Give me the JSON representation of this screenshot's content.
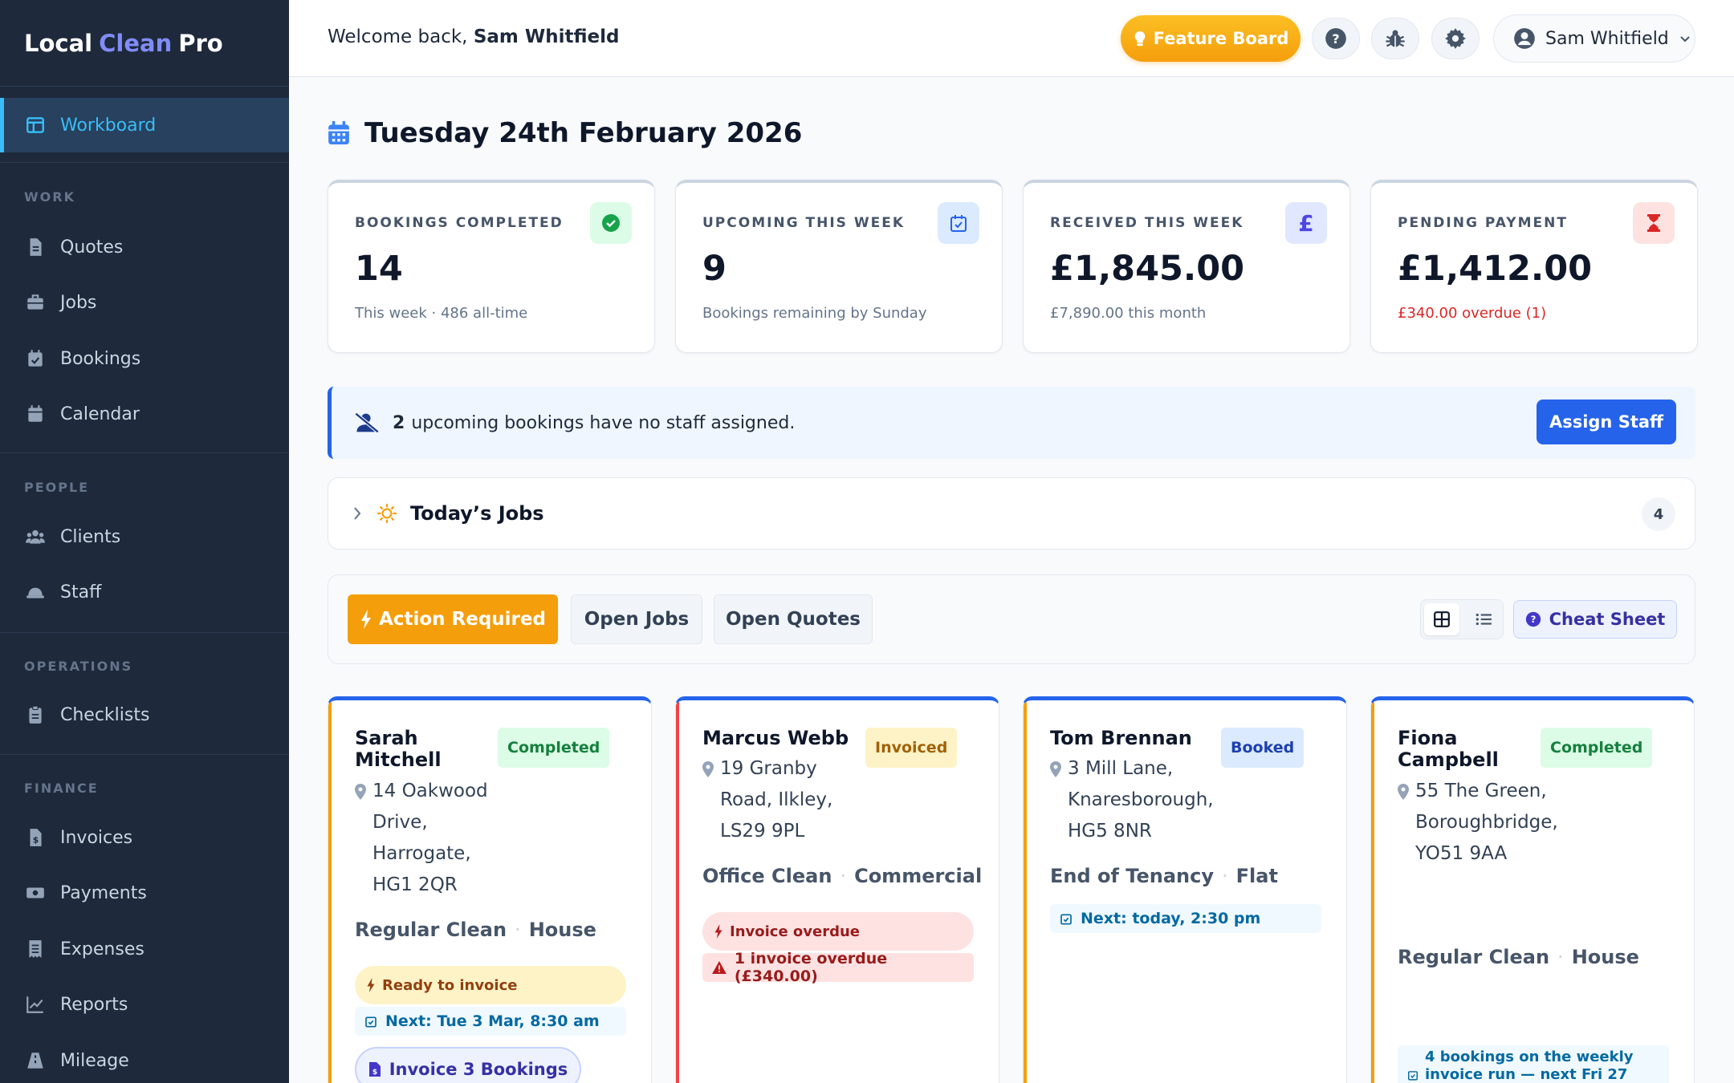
{
  "brand": {
    "part1": "Local",
    "part2": "Clean",
    "part3": "Pro"
  },
  "sidebar": {
    "active": "Workboard",
    "sections": {
      "work": "WORK",
      "people": "PEOPLE",
      "operations": "OPERATIONS",
      "finance": "FINANCE"
    },
    "items": {
      "quotes": "Quotes",
      "jobs": "Jobs",
      "bookings": "Bookings",
      "calendar": "Calendar",
      "clients": "Clients",
      "staff": "Staff",
      "checklists": "Checklists",
      "invoices": "Invoices",
      "payments": "Payments",
      "expenses": "Expenses",
      "reports": "Reports",
      "mileage": "Mileage"
    }
  },
  "topbar": {
    "welcome_prefix": "Welcome back,",
    "user_name": "Sam Whitfield",
    "feature_board": "Feature Board"
  },
  "page": {
    "date": "Tuesday 24th February 2026"
  },
  "stats": [
    {
      "label": "BOOKINGS COMPLETED",
      "value": "14",
      "sub": "This week · 486 all-time"
    },
    {
      "label": "UPCOMING THIS WEEK",
      "value": "9",
      "sub": "Bookings remaining by Sunday"
    },
    {
      "label": "RECEIVED THIS WEEK",
      "value": "£1,845.00",
      "sub": "£7,890.00 this month",
      "icon_text": "£"
    },
    {
      "label": "PENDING PAYMENT",
      "value": "£1,412.00",
      "sub": "£340.00 overdue (1)"
    }
  ],
  "alert": {
    "count": "2",
    "text": "upcoming bookings have no staff assigned.",
    "button": "Assign Staff"
  },
  "today": {
    "title": "Today’s Jobs",
    "count": "4"
  },
  "tabs": {
    "action": "Action Required",
    "jobs": "Open Jobs",
    "quotes": "Open Quotes",
    "cheat": "Cheat Sheet"
  },
  "cards": [
    {
      "name": "Sarah\nMitchell",
      "status": "Completed",
      "address": "14 Oakwood\nDrive,\nHarrogate,\nHG1 2QR",
      "service": "Regular Clean",
      "property": "House",
      "pill": "Ready to invoice",
      "next": "Next: Tue 3 Mar, 8:30 am",
      "button": "Invoice 3 Bookings"
    },
    {
      "name": "Marcus Webb",
      "status": "Invoiced",
      "address": "19 Granby\nRoad, Ilkley,\nLS29 9PL",
      "service": "Office Clean",
      "property": "Commercial",
      "pill": "Invoice overdue",
      "overdue": "1 invoice overdue (£340.00)"
    },
    {
      "name": "Tom Brennan",
      "status": "Booked",
      "address": "3 Mill Lane,\nKnaresborough,\nHG5 8NR",
      "service": "End of Tenancy",
      "property": "Flat",
      "next": "Next: today, 2:30 pm"
    },
    {
      "name": "Fiona\nCampbell",
      "status": "Completed",
      "address": "55 The Green,\nBoroughbridge,\nYO51 9AA",
      "service": "Regular Clean",
      "property": "House",
      "invoice_run_1": "4 bookings on the weekly",
      "invoice_run_2": "invoice run — next Fri 27"
    }
  ],
  "colors": {
    "sidebar_bg": "#1e293b",
    "active_accent": "#38bdf8",
    "brand_accent": "#818cf8",
    "primary": "#2563eb",
    "amber": "#f59e0b",
    "red": "#dc2626",
    "green": "#16a34a"
  }
}
